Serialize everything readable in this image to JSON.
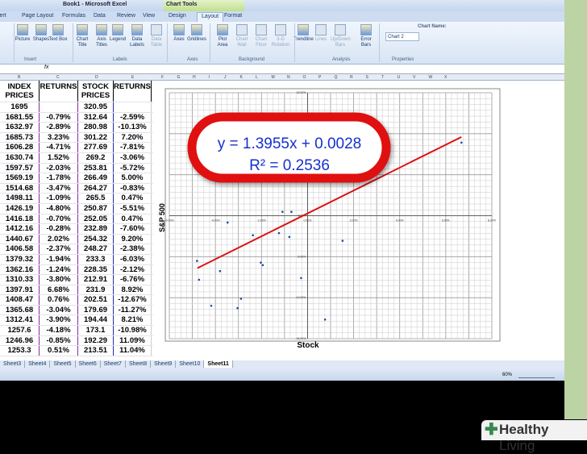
{
  "window": {
    "title": "Book1 - Microsoft Excel",
    "context_tab": "Chart Tools"
  },
  "tabs": [
    "sert",
    "Page Layout",
    "Formulas",
    "Data",
    "Review",
    "View",
    "Design",
    "Layout",
    "Format"
  ],
  "selected_tab": "Layout",
  "ribbon": {
    "buttons": [
      {
        "label": "Picture"
      },
      {
        "label": "Shapes"
      },
      {
        "label": "Text Box"
      },
      {
        "label": "Chart Title"
      },
      {
        "label": "Axis Titles"
      },
      {
        "label": "Legend"
      },
      {
        "label": "Data Labels"
      },
      {
        "label": "Data Table",
        "disabled": true
      },
      {
        "label": "Axes"
      },
      {
        "label": "Gridlines"
      },
      {
        "label": "Plot Area"
      },
      {
        "label": "Chart Wall",
        "disabled": true
      },
      {
        "label": "Chart Floor",
        "disabled": true
      },
      {
        "label": "3-D Rotation",
        "disabled": true
      },
      {
        "label": "Trendline"
      },
      {
        "label": "Lines",
        "disabled": true
      },
      {
        "label": "Up/Down Bars",
        "disabled": true
      },
      {
        "label": "Error Bars"
      }
    ],
    "groups": [
      "Insert",
      "Labels",
      "Axes",
      "Background",
      "Analysis",
      "Properties"
    ],
    "chart_name_label": "Chart Name:",
    "chart_name_value": "Chart 2"
  },
  "formula_bar": {
    "fx": "fx"
  },
  "columns": [
    "B",
    "C",
    "D",
    "E",
    "F",
    "G",
    "H",
    "I",
    "J",
    "K",
    "L",
    "M",
    "N",
    "O",
    "P",
    "Q",
    "R",
    "S",
    "T",
    "U",
    "V",
    "W",
    "X"
  ],
  "table": {
    "headers": [
      "INDEX PRICES",
      "RETURNS",
      "STOCK PRICES",
      "RETURNS"
    ],
    "first_row": [
      "1695",
      "",
      "320.95",
      ""
    ],
    "rows": [
      [
        "1681.55",
        "-0.79%",
        "312.64",
        "-2.59%"
      ],
      [
        "1632.97",
        "-2.89%",
        "280.98",
        "-10.13%"
      ],
      [
        "1685.73",
        "3.23%",
        "301.22",
        "7.20%"
      ],
      [
        "1606.28",
        "-4.71%",
        "277.69",
        "-7.81%"
      ],
      [
        "1630.74",
        "1.52%",
        "269.2",
        "-3.06%"
      ],
      [
        "1597.57",
        "-2.03%",
        "253.81",
        "-5.72%"
      ],
      [
        "1569.19",
        "-1.78%",
        "266.49",
        "5.00%"
      ],
      [
        "1514.68",
        "-3.47%",
        "264.27",
        "-0.83%"
      ],
      [
        "1498.11",
        "-1.09%",
        "265.5",
        "0.47%"
      ],
      [
        "1426.19",
        "-4.80%",
        "250.87",
        "-5.51%"
      ],
      [
        "1416.18",
        "-0.70%",
        "252.05",
        "0.47%"
      ],
      [
        "1412.16",
        "-0.28%",
        "232.89",
        "-7.60%"
      ],
      [
        "1440.67",
        "2.02%",
        "254.32",
        "9.20%"
      ],
      [
        "1406.58",
        "-2.37%",
        "248.27",
        "-2.38%"
      ],
      [
        "1379.32",
        "-1.94%",
        "233.3",
        "-6.03%"
      ],
      [
        "1362.16",
        "-1.24%",
        "228.35",
        "-2.12%"
      ],
      [
        "1310.33",
        "-3.80%",
        "212.91",
        "-6.76%"
      ],
      [
        "1397.91",
        "6.68%",
        "231.9",
        "8.92%"
      ],
      [
        "1408.47",
        "0.76%",
        "202.51",
        "-12.67%"
      ],
      [
        "1365.68",
        "-3.04%",
        "179.69",
        "-11.27%"
      ],
      [
        "1312.41",
        "-3.90%",
        "194.44",
        "8.21%"
      ],
      [
        "1257.6",
        "-4.18%",
        "173.1",
        "-10.98%"
      ],
      [
        "1246.96",
        "-0.85%",
        "192.29",
        "11.09%"
      ],
      [
        "1253.3",
        "0.51%",
        "213.51",
        "11.04%"
      ]
    ]
  },
  "chart_data": {
    "type": "scatter",
    "xlabel": "Stock",
    "ylabel": "S&P 500",
    "xlim": [
      -0.06,
      0.08
    ],
    "ylim": [
      -0.15,
      0.15
    ],
    "xticks": [
      "-6.00%",
      "-4.00%",
      "-2.00%",
      "0.00%",
      "2.00%",
      "4.00%",
      "6.00%",
      "8.00%"
    ],
    "yticks": [
      "15.00%",
      "10.00%",
      "5.00%",
      "0.00%",
      "-5.00%",
      "-10.00%",
      "-15.00%"
    ],
    "grid": true,
    "points_source": "table columns RETURNS (x) and RETURNS (y)",
    "trendline": {
      "slope": 1.3955,
      "intercept": 0.0028,
      "color": "#dd1111"
    },
    "equation": "y = 1.3955x + 0.0028",
    "r_squared": "R² = 0.2536",
    "marker_color": "#1f4e9c"
  },
  "sheets": [
    "Sheet3",
    "Sheet4",
    "Sheet5",
    "Sheet6",
    "Sheet7",
    "Sheet8",
    "Sheet9",
    "Sheet10",
    "Sheet11"
  ],
  "active_sheet": "Sheet11",
  "status": {
    "zoom": "60%"
  },
  "logo": {
    "brand_bold": "Healthy",
    "brand": "Living"
  }
}
